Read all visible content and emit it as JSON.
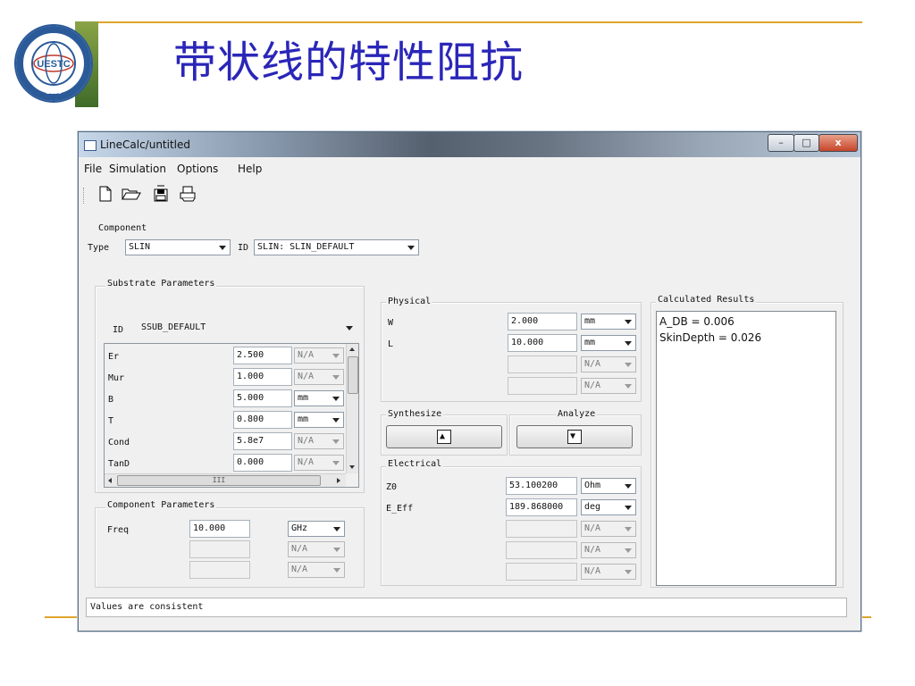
{
  "slide": {
    "title": "带状线的特性阻抗",
    "logo_text": "UESTC",
    "logo_year": "1956"
  },
  "window": {
    "title": "LineCalc/untitled",
    "controls": {
      "minimize": "–",
      "maximize": "□",
      "close": "x"
    }
  },
  "menu": [
    "File",
    "Simulation",
    "Options",
    "Help"
  ],
  "toolbar": [
    "new-icon",
    "open-icon",
    "save-icon",
    "print-icon"
  ],
  "component": {
    "label": "Component",
    "type_label": "Type",
    "type_value": "SLIN",
    "id_label": "ID",
    "id_value": "SLIN: SLIN_DEFAULT"
  },
  "substrate": {
    "label": "Substrate Parameters",
    "id_label": "ID",
    "id_value": "SSUB_DEFAULT",
    "params": [
      {
        "name": "Er",
        "value": "2.500",
        "unit": "N/A"
      },
      {
        "name": "Mur",
        "value": "1.000",
        "unit": "N/A"
      },
      {
        "name": "B",
        "value": "5.000",
        "unit": "mm"
      },
      {
        "name": "T",
        "value": "0.800",
        "unit": "mm"
      },
      {
        "name": "Cond",
        "value": "5.8e7",
        "unit": "N/A"
      },
      {
        "name": "TanD",
        "value": "0.000",
        "unit": "N/A"
      }
    ],
    "hscroll_thumb": "III"
  },
  "component_params": {
    "label": "Component Parameters",
    "freq_label": "Freq",
    "freq_value": "10.000",
    "freq_unit": "GHz",
    "na1": "N/A",
    "na2": "N/A"
  },
  "physical": {
    "label": "Physical",
    "w_label": "W",
    "w_value": "2.000",
    "w_unit": "mm",
    "l_label": "L",
    "l_value": "10.000",
    "l_unit": "mm",
    "na1": "N/A",
    "na2": "N/A"
  },
  "synthesize": {
    "label": "Synthesize",
    "icon": "▲"
  },
  "analyze": {
    "label": "Analyze",
    "icon": "▼"
  },
  "electrical": {
    "label": "Electrical",
    "z0_label": "Z0",
    "z0_value": "53.100200",
    "z0_unit": "Ohm",
    "eeff_label": "E_Eff",
    "eeff_value": "189.868000",
    "eeff_unit": "deg",
    "na1": "N/A",
    "na2": "N/A",
    "na3": "N/A"
  },
  "results": {
    "label": "Calculated Results",
    "lines": [
      "A_DB = 0.006",
      "SkinDepth = 0.026"
    ]
  },
  "status": "Values are consistent",
  "colors": {
    "title_blue": "#2a26b8",
    "accent_orange": "#e0a52a",
    "logo_blue": "#2b5a99"
  }
}
